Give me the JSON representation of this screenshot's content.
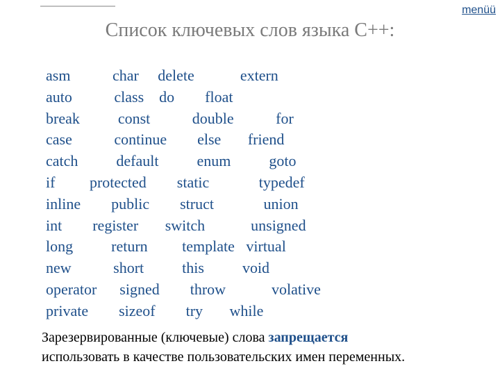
{
  "menu": {
    "label": "menüü"
  },
  "title": "Список ключевых слов языка С++:",
  "keyword_lines": [
    "asm           char     delete            extern",
    "auto           class    do        float",
    "break          const           double           for",
    "case           continue        else       friend",
    "catch          default          enum          goto",
    "if         protected        static             typedef",
    "inline        public        struct             union",
    "int        register       switch            unsigned",
    "long          return         template   virtual",
    "new           short          this          void",
    "operator      signed        throw            volative",
    "private        sizeof        try       while"
  ],
  "note": {
    "prefix": "Зарезервированные (ключевые) слова ",
    "forbid": "запрещается",
    "rest": " использовать в качестве пользовательских имен переменных."
  }
}
